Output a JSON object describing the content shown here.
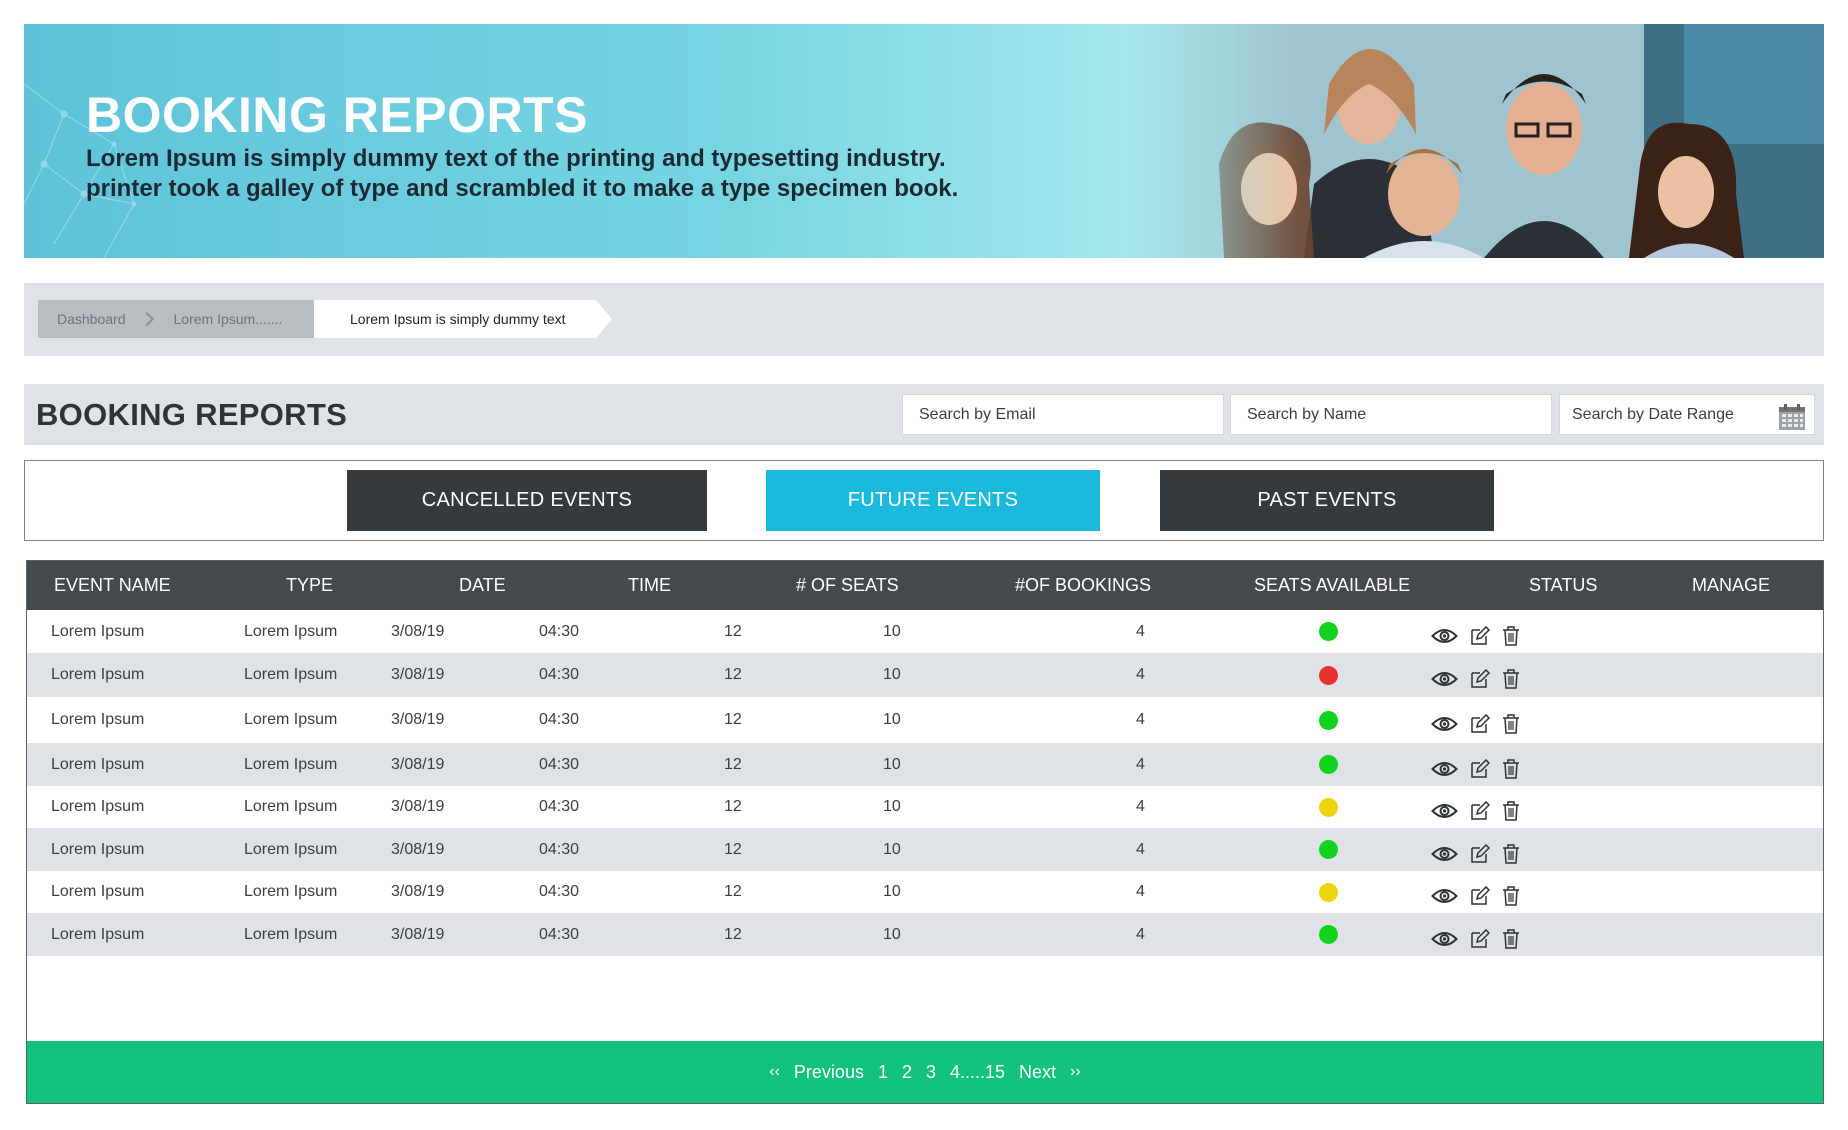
{
  "banner": {
    "title": "BOOKING REPORTS",
    "subtitle_line1": "Lorem Ipsum is simply dummy text of the printing and typesetting industry.",
    "subtitle_line2": "printer took a galley of type and scrambled it to make a type specimen book."
  },
  "breadcrumb": {
    "items": [
      "Dashboard",
      "Lorem Ipsum.......",
      "Lorem Ipsum is simply dummy text"
    ]
  },
  "section": {
    "title": "BOOKING REPORTS",
    "search_email": "Search by Email",
    "search_name": "Search by Name",
    "search_date": "Search by Date Range"
  },
  "tabs": [
    {
      "label": "CANCELLED EVENTS",
      "active": false
    },
    {
      "label": "FUTURE EVENTS",
      "active": true
    },
    {
      "label": "PAST EVENTS",
      "active": false
    }
  ],
  "table": {
    "columns": [
      "EVENT NAME",
      "TYPE",
      "DATE",
      "TIME",
      "# OF SEATS",
      "#OF BOOKINGS",
      "SEATS AVAILABLE",
      "STATUS",
      "MANAGE"
    ],
    "rows": [
      {
        "name": "Lorem Ipsum",
        "type": "Lorem Ipsum",
        "date": "3/08/19",
        "time": "04:30",
        "seats": "12",
        "bookings": "10",
        "available": "4",
        "status": "green"
      },
      {
        "name": "Lorem Ipsum",
        "type": "Lorem Ipsum",
        "date": "3/08/19",
        "time": "04:30",
        "seats": "12",
        "bookings": "10",
        "available": "4",
        "status": "red"
      },
      {
        "name": "Lorem Ipsum",
        "type": "Lorem Ipsum",
        "date": "3/08/19",
        "time": "04:30",
        "seats": "12",
        "bookings": "10",
        "available": "4",
        "status": "green"
      },
      {
        "name": "Lorem Ipsum",
        "type": "Lorem Ipsum",
        "date": "3/08/19",
        "time": "04:30",
        "seats": "12",
        "bookings": "10",
        "available": "4",
        "status": "green"
      },
      {
        "name": "Lorem Ipsum",
        "type": "Lorem Ipsum",
        "date": "3/08/19",
        "time": "04:30",
        "seats": "12",
        "bookings": "10",
        "available": "4",
        "status": "yellow"
      },
      {
        "name": "Lorem Ipsum",
        "type": "Lorem Ipsum",
        "date": "3/08/19",
        "time": "04:30",
        "seats": "12",
        "bookings": "10",
        "available": "4",
        "status": "green"
      },
      {
        "name": "Lorem Ipsum",
        "type": "Lorem Ipsum",
        "date": "3/08/19",
        "time": "04:30",
        "seats": "12",
        "bookings": "10",
        "available": "4",
        "status": "yellow"
      },
      {
        "name": "Lorem Ipsum",
        "type": "Lorem Ipsum",
        "date": "3/08/19",
        "time": "04:30",
        "seats": "12",
        "bookings": "10",
        "available": "4",
        "status": "green"
      }
    ],
    "manage_icons": [
      "eye-icon",
      "edit-icon",
      "trash-icon"
    ]
  },
  "pagination": {
    "prev_arrow": "‹‹",
    "prev": "Previous",
    "pages": [
      "1",
      "2",
      "3",
      "4.....15"
    ],
    "next": "Next",
    "next_arrow": "››"
  },
  "colors": {
    "status_green": "#13d31f",
    "status_red": "#e5322e",
    "status_yellow": "#ecd50f",
    "accent_tab": "#1bb9dc",
    "pager": "#12c27d",
    "header_dark": "#44494d"
  }
}
